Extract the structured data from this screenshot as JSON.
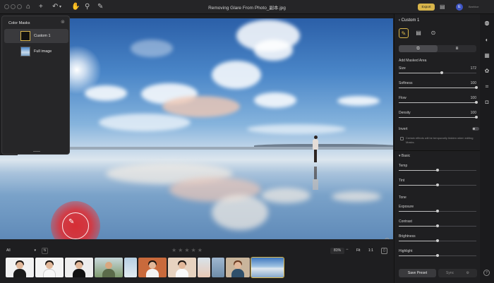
{
  "titlebar": {
    "doc_title": "Removing Glare From Photo_副本.jpg",
    "export_label": "Export",
    "avatar_initial": "E",
    "user_name": "Beehive"
  },
  "masks_panel": {
    "title": "Color Masks",
    "items": [
      {
        "label": "Custom 1"
      },
      {
        "label": "Full image"
      }
    ]
  },
  "right_panel": {
    "header": "Custom 1",
    "add_masked_area": "Add Masked Area",
    "sliders": [
      {
        "label": "Size",
        "value": "172",
        "fraction": 0.55
      },
      {
        "label": "Softness",
        "value": "100",
        "fraction": 1.0
      },
      {
        "label": "Flow",
        "value": "100",
        "fraction": 1.0
      },
      {
        "label": "Density",
        "value": "100",
        "fraction": 1.0
      }
    ],
    "invert_label": "Invert",
    "invert_hint": "Certain effects will be temporarily hidden when editing Masks.",
    "basic_label": "Basic",
    "basic_sliders": [
      {
        "label": "Temp",
        "fraction": 0.5
      },
      {
        "label": "Tint",
        "fraction": 0.5
      }
    ],
    "tone_label": "Tone",
    "tone_sliders": [
      {
        "label": "Exposure",
        "fraction": 0.5
      },
      {
        "label": "Contrast",
        "fraction": 0.5
      },
      {
        "label": "Brightness",
        "fraction": 0.5
      },
      {
        "label": "Highlight",
        "fraction": 0.5
      }
    ],
    "save_preset_label": "Save Preset",
    "sync_label": "Sync"
  },
  "bottom_bar": {
    "filter_value": "All",
    "stars": "★★★★★",
    "zoom_value": "81%",
    "fit_label": "Fit",
    "one_to_one_label": "1:1"
  },
  "colors": {
    "accent": "#d8b54a",
    "brush_red": "#dc282d",
    "panel_bg": "#1f1f21"
  }
}
